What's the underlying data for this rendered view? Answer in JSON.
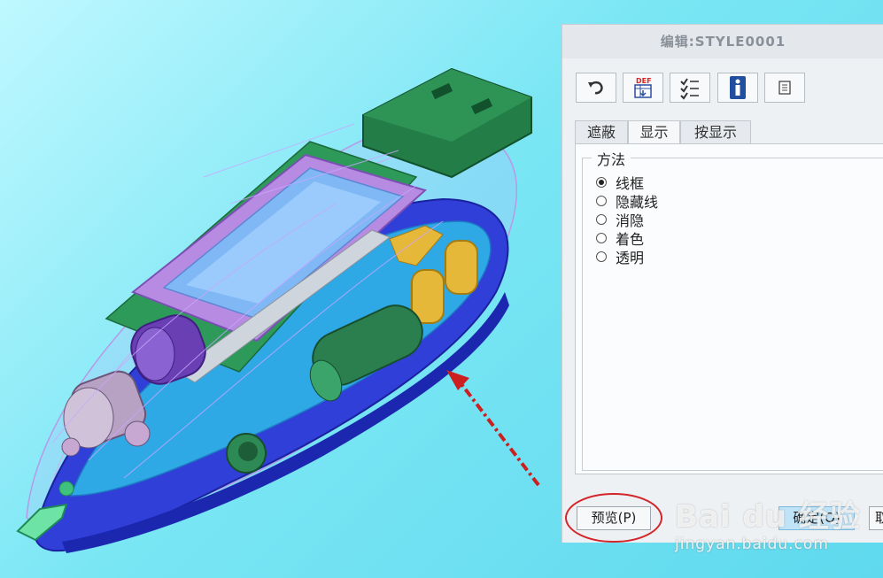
{
  "dialog": {
    "title": "编辑:STYLE0001",
    "toolbar": [
      {
        "icon": "undo-icon"
      },
      {
        "icon": "definition-icon",
        "label": "DEF"
      },
      {
        "icon": "checklist-icon"
      },
      {
        "icon": "info-icon"
      },
      {
        "icon": "properties-icon"
      }
    ],
    "tabs": [
      {
        "label": "遮蔽",
        "active": false
      },
      {
        "label": "显示",
        "active": true
      },
      {
        "label": "按显示",
        "active": false
      }
    ],
    "method": {
      "title": "方法",
      "options": [
        {
          "label": "线框",
          "selected": true
        },
        {
          "label": "隐藏线",
          "selected": false
        },
        {
          "label": "消隐",
          "selected": false
        },
        {
          "label": "着色",
          "selected": false
        },
        {
          "label": "透明",
          "selected": false
        }
      ]
    },
    "buttons": {
      "preview": "预览(P)",
      "ok": "确定(O)",
      "cancel": "取"
    }
  },
  "watermark": {
    "brand": "Bai du 经验",
    "url": "jingyan.baidu.com"
  },
  "colors": {
    "viewport_bg": "#7ae6f4",
    "usb_green": "#1f7a45",
    "body_blue": "#2f3fd8",
    "pcb_purple": "#9b59c9",
    "arrow_red": "#cc1f1f",
    "highlight_red": "#d3262b",
    "ok_button": "#bfe3f7"
  }
}
